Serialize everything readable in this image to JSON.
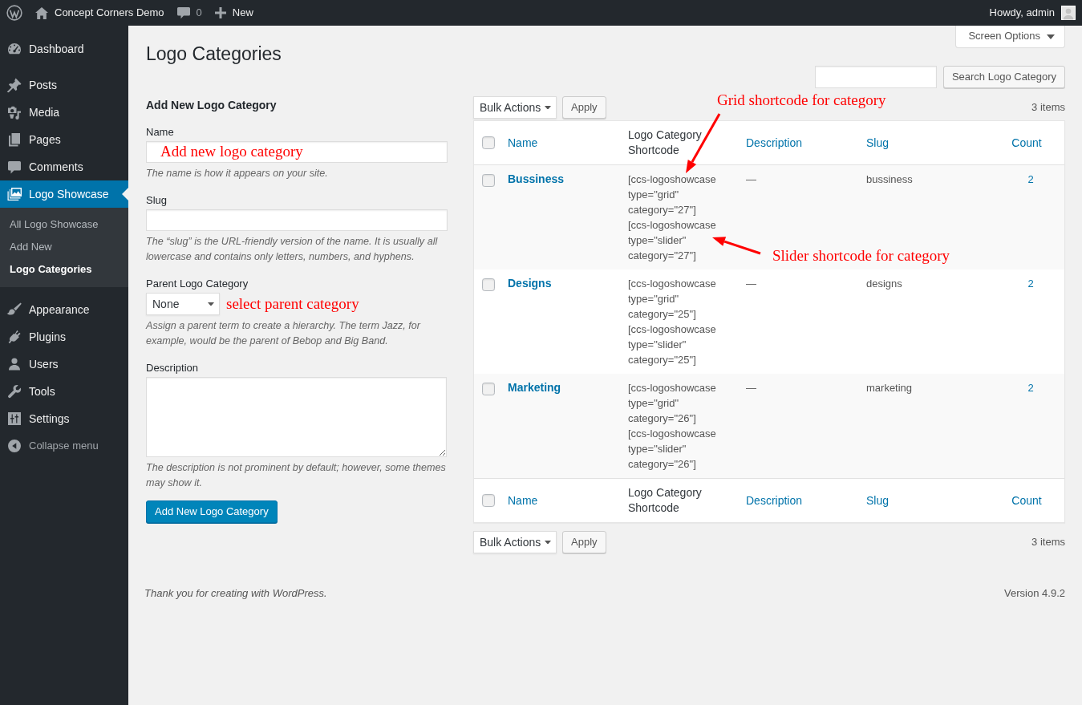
{
  "admin_bar": {
    "site_name": "Concept Corners Demo",
    "comments": "0",
    "new": "New",
    "account": "Howdy, admin"
  },
  "sidebar": {
    "groups": [
      {
        "items": [
          {
            "label": "Dashboard",
            "selected": false
          }
        ]
      },
      {
        "items": [
          {
            "label": "Posts",
            "selected": false
          },
          {
            "label": "Media",
            "selected": false
          },
          {
            "label": "Pages",
            "selected": false
          },
          {
            "label": "Comments",
            "selected": false
          },
          {
            "label": "Logo Showcase",
            "selected": true,
            "children": [
              {
                "label": "All Logo Showcase",
                "selected": false
              },
              {
                "label": "Add New",
                "selected": false
              },
              {
                "label": "Logo Categories",
                "selected": true
              }
            ]
          }
        ]
      },
      {
        "items": [
          {
            "label": "Appearance",
            "selected": false
          },
          {
            "label": "Plugins",
            "selected": false
          },
          {
            "label": "Users",
            "selected": false
          },
          {
            "label": "Tools",
            "selected": false
          },
          {
            "label": "Settings",
            "selected": false
          }
        ]
      }
    ],
    "collapse": "Collapse menu"
  },
  "screen_options": "Screen Options",
  "page_title": "Logo Categories",
  "form": {
    "heading": "Add New Logo Category",
    "fields": [
      {
        "kind": "text",
        "label": "Name",
        "annotation": "Add new logo category",
        "help": "The name is how it appears on your site."
      },
      {
        "kind": "text",
        "label": "Slug",
        "help": "The “slug” is the URL-friendly version of the name. It is usually all lowercase and contains only letters, numbers, and hyphens."
      },
      {
        "kind": "select",
        "label": "Parent Logo Category",
        "value": "None",
        "annotation": "select parent category",
        "help": "Assign a parent term to create a hierarchy. The term Jazz, for example, would be the parent of Bebop and Big Band."
      },
      {
        "kind": "textarea",
        "label": "Description",
        "help": "The description is not prominent by default; however, some themes may show it."
      }
    ],
    "submit": "Add New Logo Category"
  },
  "search": {
    "button": "Search Logo Category"
  },
  "tablenav_top": {
    "bulk_actions": "Bulk Actions",
    "apply": "Apply",
    "count": "3 items"
  },
  "table": {
    "header": {
      "checked": false,
      "columns": [
        {
          "label": "Name",
          "sortable": true
        },
        {
          "label": "Logo Category Shortcode",
          "sortable": false
        },
        {
          "label": "Description",
          "sortable": true
        },
        {
          "label": "Slug",
          "sortable": true
        },
        {
          "label": "Count",
          "sortable": true
        }
      ]
    },
    "rows": [
      {
        "checked": false,
        "name": "Bussiness",
        "shortcodes": [
          "[ccs-logoshowcase type=\"grid\" category=\"27\"]",
          "[ccs-logoshowcase type=\"slider\" category=\"27\"]"
        ],
        "description": "—",
        "slug": "bussiness",
        "count": "2"
      },
      {
        "checked": false,
        "name": "Designs",
        "shortcodes": [
          "[ccs-logoshowcase type=\"grid\" category=\"25\"]",
          "[ccs-logoshowcase type=\"slider\" category=\"25\"]"
        ],
        "description": "—",
        "slug": "designs",
        "count": "2"
      },
      {
        "checked": false,
        "name": "Marketing",
        "shortcodes": [
          "[ccs-logoshowcase type=\"grid\" category=\"26\"]",
          "[ccs-logoshowcase type=\"slider\" category=\"26\"]"
        ],
        "description": "—",
        "slug": "marketing",
        "count": "2"
      }
    ],
    "footer": {
      "checked": false,
      "columns": [
        {
          "label": "Name",
          "sortable": true
        },
        {
          "label": "Logo Category Shortcode",
          "sortable": false
        },
        {
          "label": "Description",
          "sortable": true
        },
        {
          "label": "Slug",
          "sortable": true
        },
        {
          "label": "Count",
          "sortable": true
        }
      ]
    },
    "annotations": [
      {
        "text": "Grid shortcode for category"
      },
      {
        "text": "Slider shortcode for category"
      }
    ]
  },
  "tablenav_bottom": {
    "bulk_actions": "Bulk Actions",
    "apply": "Apply",
    "count": "3 items"
  },
  "footer": {
    "credit": "Thank you for creating with ",
    "link": "WordPress",
    "credit_end": ".",
    "version": "Version 4.9.2"
  }
}
